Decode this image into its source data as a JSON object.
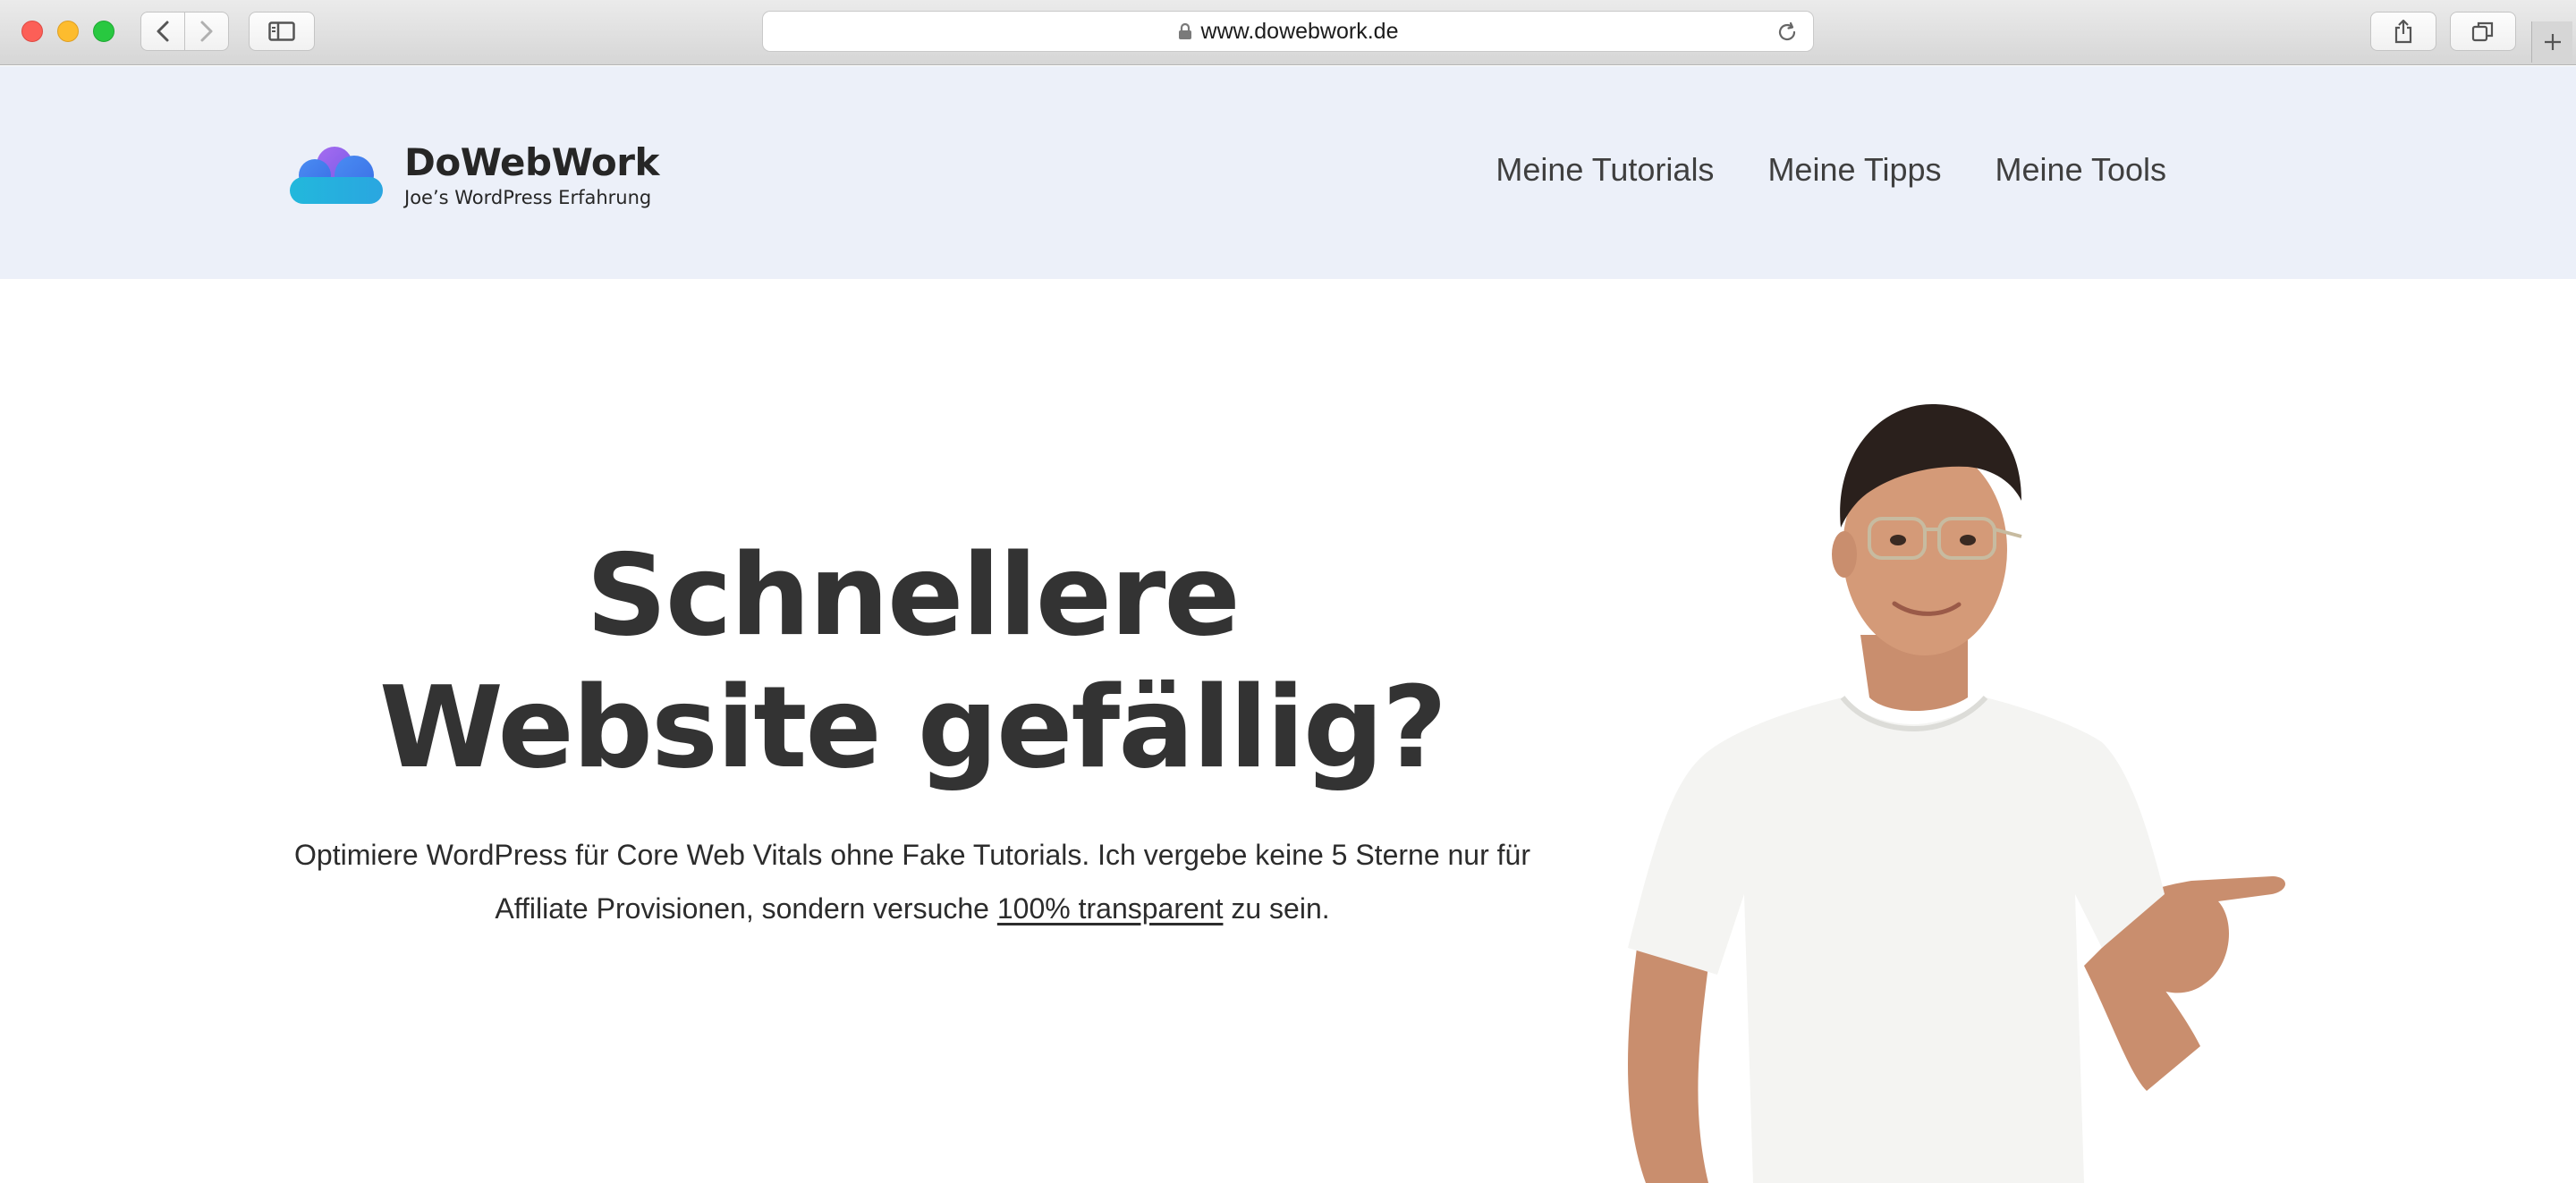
{
  "browser": {
    "url": "www.dowebwork.de"
  },
  "site": {
    "brand": {
      "name": "DoWebWork",
      "tagline": "Joe’s WordPress Erfahrung"
    },
    "nav": [
      {
        "label": "Meine Tutorials"
      },
      {
        "label": "Meine Tipps"
      },
      {
        "label": "Meine Tools"
      }
    ]
  },
  "hero": {
    "title_line1": "Schnellere",
    "title_line2": "Website gefällig?",
    "text_line1": "Optimiere WordPress für Core Web Vitals ohne Fake Tutorials. Ich vergebe keine 5 Sterne nur für",
    "text_line2_before": "Affiliate Provisionen, sondern versuche ",
    "text_link": "100% transparent",
    "text_line2_after": " zu sein."
  },
  "colors": {
    "header_bg": "#ecf0f9",
    "text_dark": "#333333"
  }
}
